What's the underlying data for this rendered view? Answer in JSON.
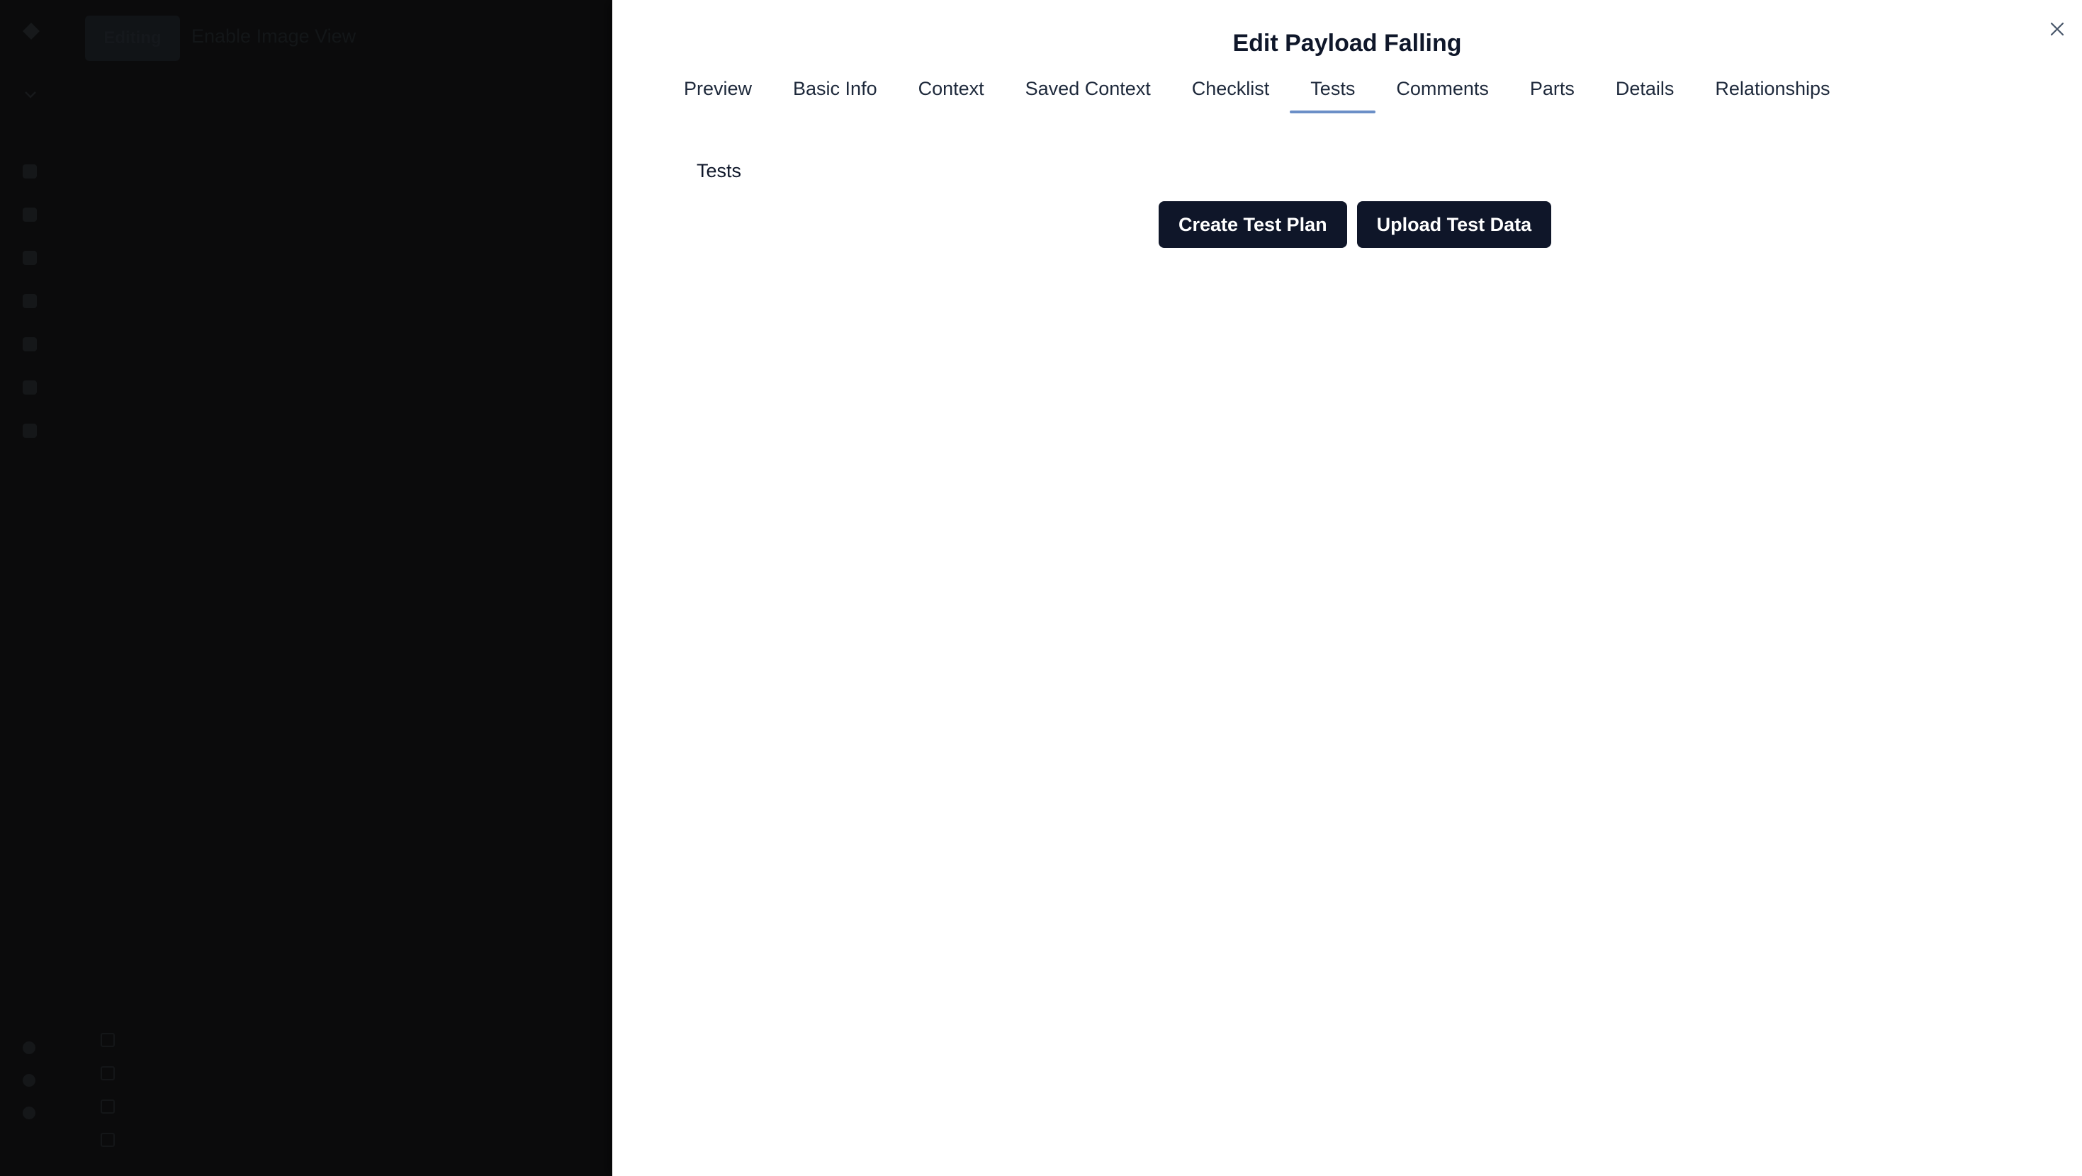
{
  "background_app": {
    "active_tab_label": "Editing",
    "toggle_label": "Enable Image View"
  },
  "drawer": {
    "title": "Edit Payload Falling",
    "close_icon": "close-icon",
    "tabs": [
      {
        "label": "Preview",
        "active": false
      },
      {
        "label": "Basic Info",
        "active": false
      },
      {
        "label": "Context",
        "active": false
      },
      {
        "label": "Saved Context",
        "active": false
      },
      {
        "label": "Checklist",
        "active": false
      },
      {
        "label": "Tests",
        "active": true
      },
      {
        "label": "Comments",
        "active": false
      },
      {
        "label": "Parts",
        "active": false
      },
      {
        "label": "Details",
        "active": false
      },
      {
        "label": "Relationships",
        "active": false
      }
    ],
    "section_label": "Tests",
    "buttons": {
      "create_test_plan": "Create Test Plan",
      "upload_test_data": "Upload Test Data"
    }
  },
  "colors": {
    "accent_underline": "#6b8fc7",
    "button_bg": "#0f1629",
    "overlay_bg": "#0b0b0c"
  }
}
